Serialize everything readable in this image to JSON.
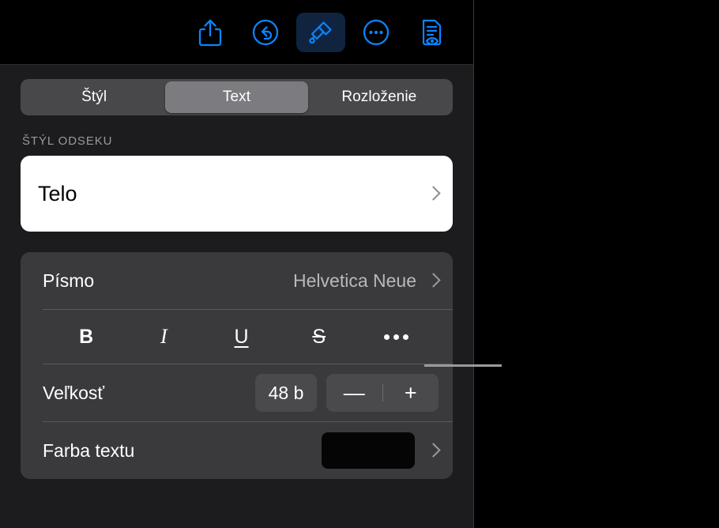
{
  "toolbar": {
    "buttons": [
      {
        "name": "share-icon",
        "label": "Zdieľať",
        "active": false
      },
      {
        "name": "undo-icon",
        "label": "Späť",
        "active": false
      },
      {
        "name": "brush-icon",
        "label": "Formát",
        "active": true
      },
      {
        "name": "more-icon",
        "label": "Ďalšie",
        "active": false
      },
      {
        "name": "document-view-icon",
        "label": "Dokument",
        "active": false
      }
    ],
    "accent_color": "#0a84ff",
    "active_bg_color": "#102440"
  },
  "segmented_control": {
    "tabs": [
      {
        "label": "Štýl",
        "selected": false
      },
      {
        "label": "Text",
        "selected": true
      },
      {
        "label": "Rozloženie",
        "selected": false
      }
    ]
  },
  "paragraph_style": {
    "section_label": "ŠTÝL ODSEKU",
    "value": "Telo"
  },
  "font": {
    "label": "Písmo",
    "value": "Helvetica Neue"
  },
  "format": {
    "bold": "B",
    "italic": "I",
    "underline": "U",
    "strikethrough": "S",
    "more": "•••"
  },
  "size": {
    "label": "Veľkosť",
    "value": "48 b",
    "decrement": "—",
    "increment": "+"
  },
  "text_color": {
    "label": "Farba textu",
    "swatch_color": "#050505"
  },
  "colors": {
    "panel_bg": "#1c1c1e",
    "card_bg": "#3a3a3c",
    "segmented_track": "#48484a",
    "segmented_selected": "#7c7c80",
    "canvas_bg": "#000000",
    "callout_line": "#9a9a9e"
  }
}
